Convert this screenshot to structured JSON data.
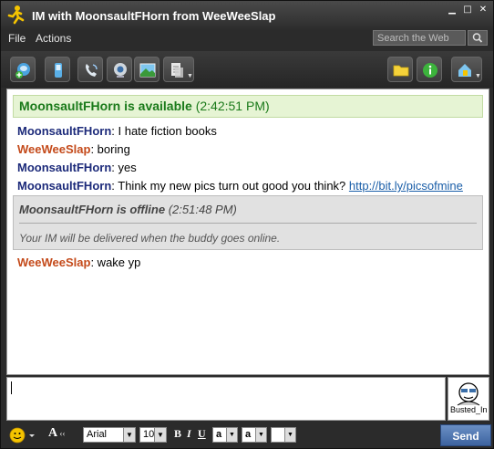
{
  "window": {
    "title": "IM with MoonsaultFHorn from WeeWeeSlap"
  },
  "menu": {
    "file": "File",
    "actions": "Actions"
  },
  "search": {
    "placeholder": "Search the Web"
  },
  "chat": {
    "available_status": {
      "name": "MoonsaultFHorn is available",
      "time": "(2:42:51 PM)"
    },
    "messages": [
      {
        "sender": "MoonsaultFHorn",
        "text": ": I hate fiction books"
      },
      {
        "sender": "WeeWeeSlap",
        "text": ": boring"
      },
      {
        "sender": "MoonsaultFHorn",
        "text": ": yes"
      },
      {
        "sender": "MoonsaultFHorn",
        "text": ": Think my new pics turn out good you think? ",
        "link": "http://bit.ly/picsofmine"
      }
    ],
    "offline_status": {
      "name": "MoonsaultFHorn is offline",
      "time": "(2:51:48 PM)",
      "note": "Your IM will be delivered when the buddy goes online."
    },
    "after_messages": [
      {
        "sender": "WeeWeeSlap",
        "text": ": wake yp"
      }
    ]
  },
  "buddy_icon": {
    "label": "Busted_In"
  },
  "format": {
    "font": "Arial",
    "size": "10",
    "bold": "B",
    "italic": "I",
    "underline": "U",
    "text_color": "a",
    "bg_color": "a",
    "send": "Send"
  },
  "colors": {
    "sender_self": "#c44a1a",
    "sender_buddy": "#1c2a7a",
    "available": "#1a7a1a",
    "send_button": "#3d63a0"
  }
}
